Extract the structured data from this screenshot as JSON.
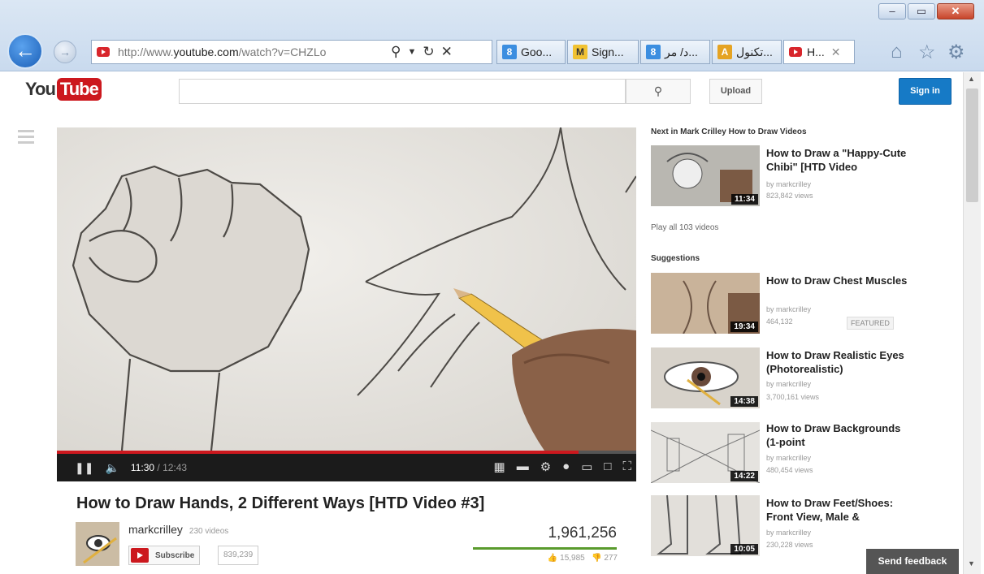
{
  "browser": {
    "url_prefix": "http://www.",
    "url_domain": "youtube.com",
    "url_rest": "/watch?v=CHZLo",
    "tabs": [
      {
        "label": "Goo...",
        "icon": "8"
      },
      {
        "label": "Sign...",
        "icon": "M"
      },
      {
        "label": "د/ مر...",
        "icon": "8"
      },
      {
        "label": "تكنول...",
        "icon": "A"
      },
      {
        "label": "H...",
        "icon": "yt"
      }
    ],
    "window_buttons": [
      "–",
      "▭",
      "✕"
    ]
  },
  "header": {
    "logo_you": "You",
    "logo_tube": "Tube",
    "search_placeholder": "",
    "search_icon": "search-icon",
    "upload_label": "Upload",
    "signin_label": "Sign in"
  },
  "player": {
    "current_time": "11:30",
    "duration": "12:43",
    "progress": 0.9
  },
  "video": {
    "title": "How to Draw Hands, 2 Different Ways [HTD Video #3]",
    "channel": "markcrilley",
    "video_count": "230 videos",
    "subscribe_label": "Subscribe",
    "subscriber_count": "839,239",
    "views": "1,961,256",
    "likes": "15,985",
    "dislikes": "277"
  },
  "sidebar": {
    "next_heading": "Next in Mark Crilley How to Draw Videos",
    "next_item": {
      "title": "How to Draw a \"Happy-Cute Chibi\" [HTD Video",
      "by": "by markcrilley",
      "views": "823,842 views",
      "duration": "11:34"
    },
    "play_all": "Play all 103 videos",
    "suggestions_heading": "Suggestions",
    "suggestions": [
      {
        "title": "How to Draw Chest Muscles",
        "by": "by markcrilley",
        "views": "464,132",
        "duration": "19:34",
        "badge": "FEATURED"
      },
      {
        "title": "How to Draw Realistic Eyes (Photorealistic)",
        "by": "by markcrilley",
        "views": "3,700,161 views",
        "duration": "14:38",
        "badge": ""
      },
      {
        "title": "How to Draw Backgrounds (1-point",
        "by": "by markcrilley",
        "views": "480,454 views",
        "duration": "14:22",
        "badge": ""
      },
      {
        "title": "How to Draw Feet/Shoes: Front View, Male &",
        "by": "by markcrilley",
        "views": "230,228 views",
        "duration": "10:05",
        "badge": ""
      }
    ],
    "feedback_label": "Send feedback"
  }
}
